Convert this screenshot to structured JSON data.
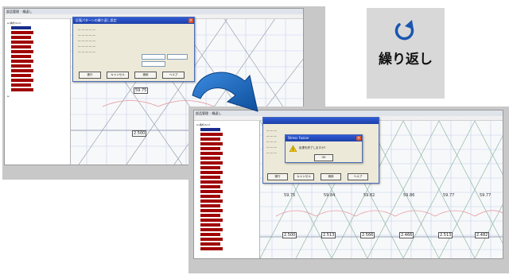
{
  "icon": {
    "label": "繰り返し",
    "glyph": "rotate-clockwise-icon"
  },
  "left_screenshot": {
    "dialog_title": "反復パターンの繰り返し設定",
    "dialog_buttons": [
      "実行",
      "キャンセル",
      "適用",
      "ヘルプ"
    ],
    "measure_top": "59.75",
    "measure_bottom": "2.500"
  },
  "right_screenshot": {
    "alert_title": "Stress Fusion",
    "alert_message": "処理を終了しますか?",
    "alert_ok": "OK",
    "dialog_buttons": [
      "実行",
      "キャンセル",
      "適用",
      "ヘルプ"
    ],
    "measures_top": [
      "59.75",
      "59.84",
      "59.82",
      "59.86",
      "59.77",
      "59.77"
    ],
    "measures_bottom": [
      "2.500",
      "2.513",
      "2.566",
      "2.466",
      "2.513",
      "2.482"
    ]
  },
  "colors": {
    "arrow_blue": "#1f6fc0",
    "icon_blue": "#1a56b0",
    "tree_red": "#a00000",
    "grid": "#b9c9e6"
  }
}
